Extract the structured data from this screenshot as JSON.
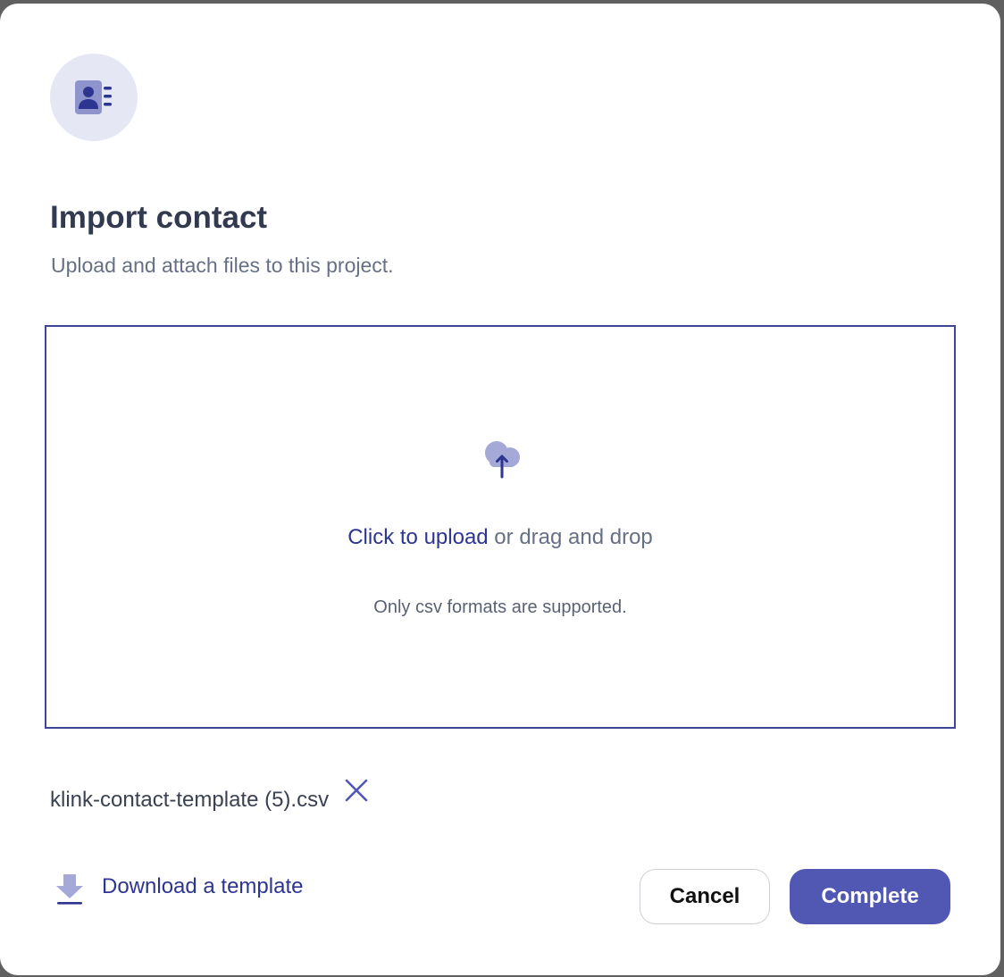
{
  "dialog": {
    "title": "Import contact",
    "subtitle": "Upload and attach files to this project.",
    "header_icon": "contact-book-icon"
  },
  "dropzone": {
    "icon": "upload-cloud-icon",
    "upload_link": "Click to upload",
    "upload_rest": " or drag and drop",
    "formats_hint": "Only csv formats are supported."
  },
  "file": {
    "name": "klink-contact-template (5).csv",
    "remove_icon": "close-icon"
  },
  "footer": {
    "download_icon": "download-icon",
    "download_label": "Download a template",
    "cancel_label": "Cancel",
    "complete_label": "Complete"
  },
  "colors": {
    "accent": "#5058b4",
    "link": "#2d3591",
    "icon_bg": "#e5e7f4",
    "icon_light": "#a4a9d8",
    "dropzone_border": "#3e4596"
  }
}
